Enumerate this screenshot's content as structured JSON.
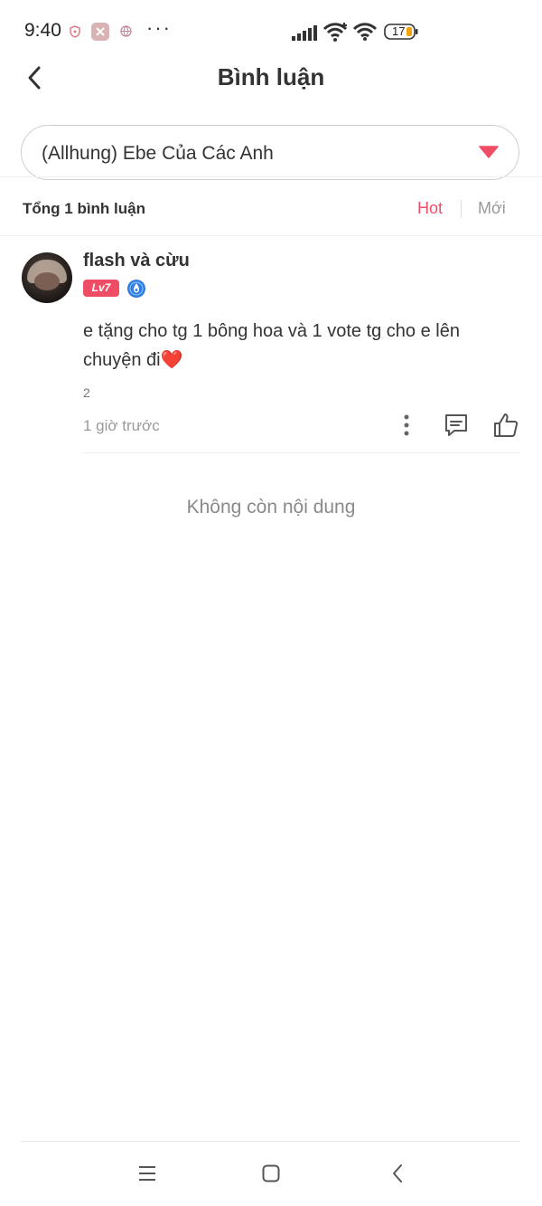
{
  "status_bar": {
    "time": "9:40",
    "more": "···",
    "battery": "17"
  },
  "header": {
    "title": "Bình luận"
  },
  "chapter_select": {
    "value": "(Allhung) Ebe Của Các Anh"
  },
  "comments_header": {
    "count_label": "Tổng 1 bình luận",
    "sort_hot": "Hot",
    "sort_new": "Mới"
  },
  "comments": [
    {
      "username": "flash và cừu",
      "level": "Lv7",
      "text": "e tặng cho tg 1 bông hoa và 1 vote tg cho e lên chuyện đi",
      "emoji": "❤️",
      "sub_count": "2",
      "time": "1 giờ trước"
    }
  ],
  "footer": {
    "no_more": "Không còn nội dung"
  },
  "colors": {
    "accent": "#ef4d66",
    "muted": "#9a9a9a"
  }
}
